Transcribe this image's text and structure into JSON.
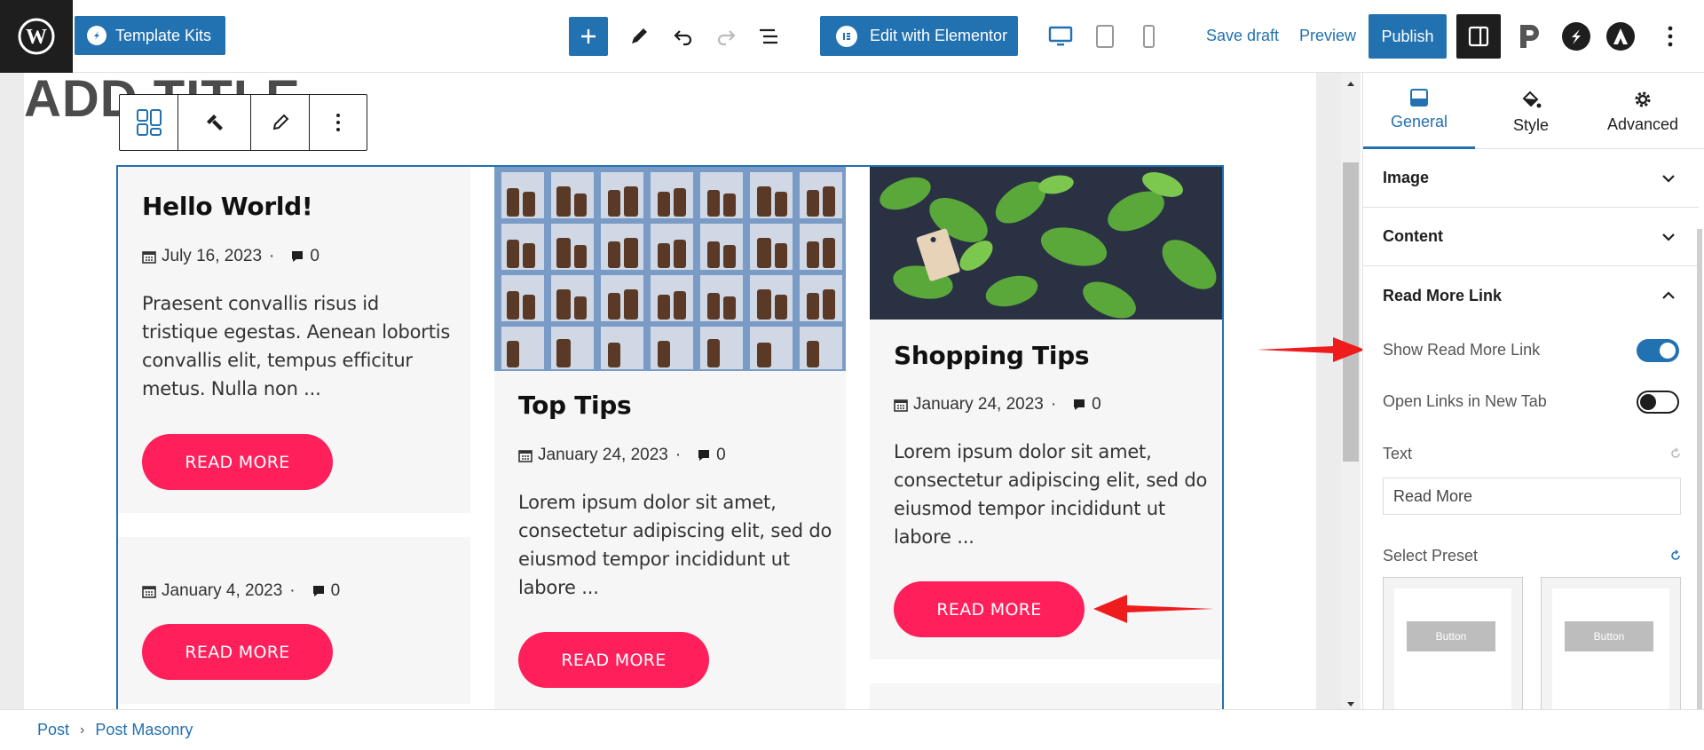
{
  "toolbar": {
    "template_kits_label": "Template Kits",
    "edit_elementor_label": "Edit with Elementor",
    "save_draft_label": "Save draft",
    "preview_label": "Preview",
    "publish_label": "Publish"
  },
  "editor": {
    "title_placeholder": "ADD TITLE"
  },
  "posts": [
    {
      "title": "Hello World!",
      "date": "July 16, 2023",
      "comments": "0",
      "excerpt": "Praesent convallis risus id tristique egestas. Aenean lobortis convallis elit, tempus efficitur metus. Nulla non ...",
      "button": "READ MORE"
    },
    {
      "title": "Top Tips",
      "date": "January 24, 2023",
      "comments": "0",
      "excerpt": "Lorem ipsum dolor sit amet, consectetur adipiscing elit, sed do eiusmod tempor incididunt ut labore ...",
      "button": "READ MORE"
    },
    {
      "title": "Shopping Tips",
      "date": "January 24, 2023",
      "comments": "0",
      "excerpt": "Lorem ipsum dolor sit amet, consectetur adipiscing elit, sed do eiusmod tempor incididunt ut labore ...",
      "button": "READ MORE"
    },
    {
      "title": "",
      "date": "January 4, 2023",
      "comments": "0",
      "excerpt": "",
      "button": "READ MORE"
    }
  ],
  "panel": {
    "tabs": [
      {
        "label": "General",
        "icon": "block-icon"
      },
      {
        "label": "Style",
        "icon": "paint-bucket-icon"
      },
      {
        "label": "Advanced",
        "icon": "gear-icon"
      }
    ],
    "sections": [
      {
        "label": "Image"
      },
      {
        "label": "Content"
      },
      {
        "label": "Read More Link"
      }
    ],
    "show_read_more_label": "Show Read More Link",
    "show_read_more_on": true,
    "open_new_tab_label": "Open Links in New Tab",
    "open_new_tab_on": false,
    "text_label": "Text",
    "text_value": "Read More",
    "select_preset_label": "Select Preset",
    "preset_button_label": "Button"
  },
  "breadcrumb": {
    "items": [
      "Post",
      "Post Masonry"
    ]
  },
  "colors": {
    "accent": "#2271b1",
    "button": "#ff1f5a",
    "arrow": "#ee1c1c"
  }
}
